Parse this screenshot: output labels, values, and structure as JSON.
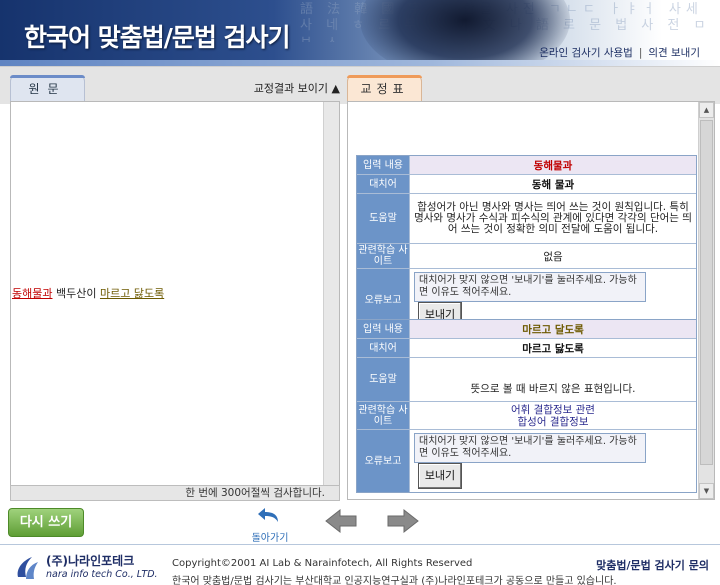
{
  "header": {
    "title": "한국어 맞춤법/문법 검사기",
    "background_text": "語 法 韓 國 字 文 한글 사전 ㄱㄴㄷ ㅏㅑㅓ 사세 사 네  ㅎ 르 무 니 이 文 나 語 로 문 법 사 전 ㅁ ㅂ ㅅ",
    "links": [
      "온라인 검사기 사용법",
      "의견 보내기"
    ]
  },
  "left": {
    "tab_label": "원문",
    "show_results_label": "교정결과 보이기 ▲",
    "source": {
      "error1": "동해물과",
      "middle": " 백두산이 ",
      "error2": "마르고 닳도록"
    },
    "footer_text": "한 번에 300어절씩 검사합니다."
  },
  "right": {
    "tab_label": "교정표",
    "labels": {
      "input": "입력 내용",
      "suggestion": "대치어",
      "help": "도움말",
      "sites": "관련학습 사이트",
      "report": "오류보고"
    },
    "entries": [
      {
        "input": "동해물과",
        "suggestion": "동해 물과",
        "help": "합성어가 아닌 명사와 명사는 띄어 쓰는 것이 원칙입니다. 특히 명사와 명사가 수식과 피수식의 관계에 있다면 각각의 단어는 띄어 쓰는 것이 정확한 의미 전달에 도움이 됩니다.",
        "sites": [
          "없음"
        ],
        "report_text": "대치어가 맞지 않으면 '보내기'를 눌러주세요. 가능하면 이유도 적어주세요.",
        "send_label": "보내기"
      },
      {
        "input": "마르고 달도록",
        "suggestion": "마르고 닳도록",
        "help": "뜻으로 볼 때 바르지 않은 표현입니다.",
        "sites": [
          "어휘 결합정보 관련",
          "합성어 결합정보"
        ],
        "report_text": "대치어가 맞지 않으면 '보내기'를 눌러주세요. 가능하면 이유도 적어주세요.",
        "send_label": "보내기"
      }
    ]
  },
  "controls": {
    "rewrite_label": "다시 쓰기",
    "back_label": "돌아가기"
  },
  "footer": {
    "logo_korean": "(주)나라인포테크",
    "logo_english": "nara info tech Co., LTD.",
    "copyright": "Copyright©2001 AI Lab & Narainfotech, All Rights Reserved",
    "description": "한국어 맞춤법/문법 검사기는 부산대학교 인공지능연구실과 (주)나라인포테크가 공동으로 만들고 있습니다.",
    "inquiry": "맞춤법/문법 검사기 문의"
  },
  "colors": {
    "header_dark": "#16336d",
    "label_blue": "#6c94c8",
    "error_red": "#c00000",
    "error_olive": "#6d5a00",
    "rewrite_green": "#5f9e35"
  }
}
